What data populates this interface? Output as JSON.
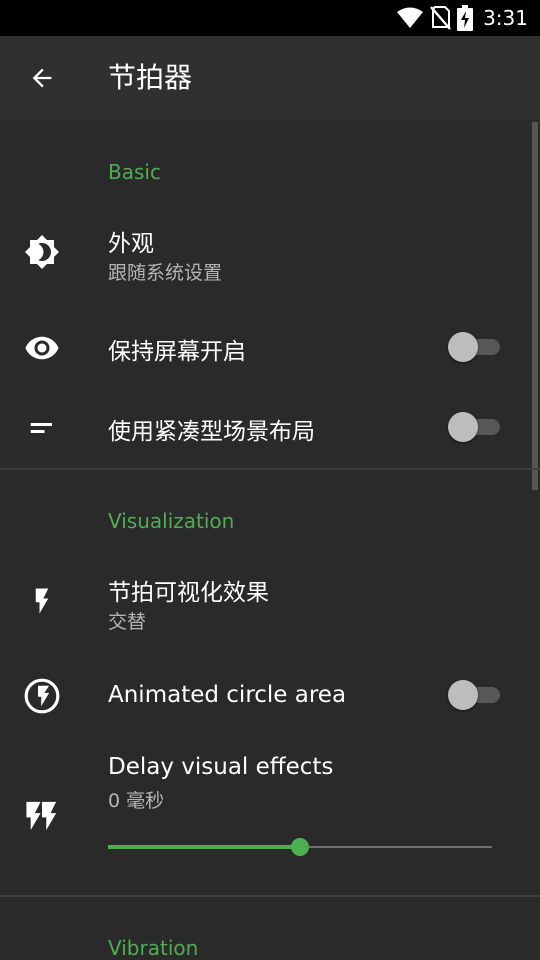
{
  "status_bar": {
    "time": "3:31",
    "icons": [
      "wifi-icon",
      "no-sim-icon",
      "battery-charging-icon"
    ]
  },
  "app_bar": {
    "back_icon": "arrow-back-icon",
    "title": "节拍器"
  },
  "sections": {
    "basic": {
      "header": "Basic",
      "appearance": {
        "icon": "brightness-icon",
        "title": "外观",
        "subtitle": "跟随系统设置"
      },
      "keep_screen_on": {
        "icon": "eye-icon",
        "title": "保持屏幕开启",
        "enabled": false
      },
      "compact_landscape": {
        "icon": "short-text-icon",
        "title": "使用紧凑型场景布局",
        "enabled": false
      }
    },
    "visualization": {
      "header": "Visualization",
      "beat_visual": {
        "icon": "flash-icon",
        "title": "节拍可视化效果",
        "subtitle": "交替"
      },
      "animated_circle": {
        "icon": "flash-circle-icon",
        "title": "Animated circle area",
        "enabled": false
      },
      "delay_visual": {
        "icon": "double-flash-icon",
        "title": "Delay visual effects",
        "subtitle": "0 毫秒",
        "slider_fraction": 0.5
      }
    },
    "vibration": {
      "header": "Vibration"
    }
  },
  "colors": {
    "accent": "#4caf50",
    "background": "#2a2a2a",
    "app_bar": "#303030",
    "status_bar": "#000000"
  }
}
